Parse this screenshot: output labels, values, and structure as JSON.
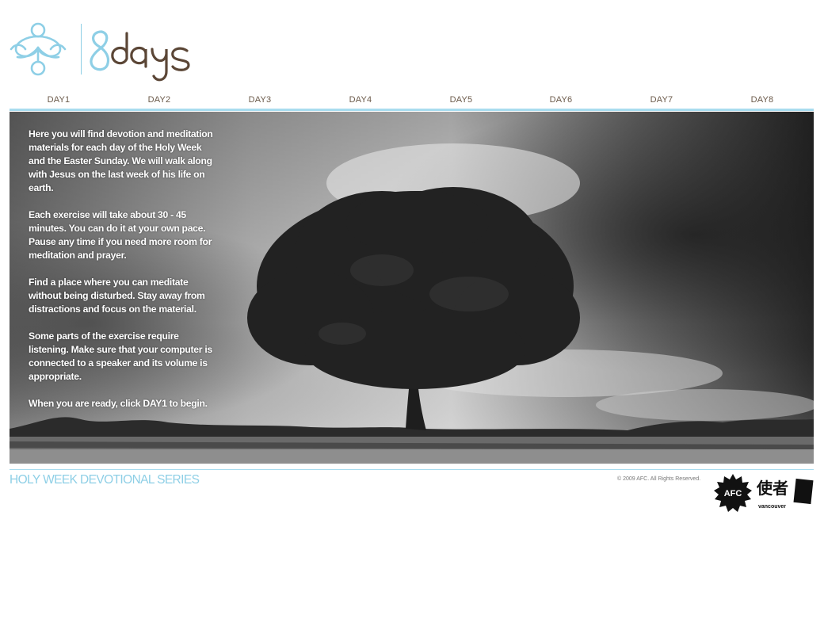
{
  "brand": {
    "wordmark": "8days"
  },
  "nav": {
    "items": [
      {
        "label": "DAY1"
      },
      {
        "label": "DAY2"
      },
      {
        "label": "DAY3"
      },
      {
        "label": "DAY4"
      },
      {
        "label": "DAY5"
      },
      {
        "label": "DAY6"
      },
      {
        "label": "DAY7"
      },
      {
        "label": "DAY8"
      }
    ]
  },
  "intro": {
    "paragraphs": [
      "Here you will find devotion and meditation materials for each day of the Holy Week and the Easter Sunday.  We will walk along with Jesus on the last week of his life on earth.",
      "Each exercise will take about 30 - 45 minutes.  You can do it at your own pace. Pause any time if you need more room for meditation and prayer.",
      "Find a place where you can meditate without being disturbed.  Stay away from distractions and focus on the material.",
      "Some parts of the exercise require listening.  Make sure that your computer is connected to a speaker and its volume is appropriate.",
      "When you are ready, click DAY1 to begin."
    ]
  },
  "footer": {
    "series_title": "HOLY WEEK  DEVOTIONAL SERIES",
    "copyright": "© 2009 AFC. All Rights Reserved.",
    "badge_text": "AFC",
    "chinese_logo_text": "使者",
    "chinese_logo_sub": "vancouver"
  },
  "colors": {
    "accent_blue": "#8ecfe6",
    "brown": "#5b4636",
    "nav_text": "#6b5a4a"
  },
  "icons": {
    "logo_mark": "knot-cross-icon",
    "hero": "tree-landscape-photo"
  }
}
